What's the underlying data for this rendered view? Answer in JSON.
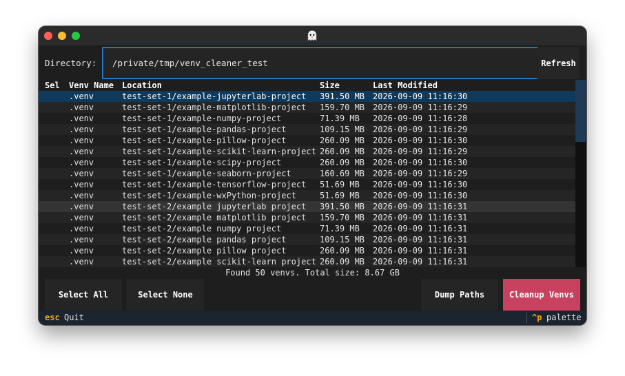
{
  "directory": {
    "label": "Directory:",
    "value": "/private/tmp/venv_cleaner_test"
  },
  "refresh_label": "Refresh",
  "table": {
    "headers": {
      "sel": "Sel",
      "name": "Venv Name",
      "location": "Location",
      "size": "Size",
      "modified": "Last Modified"
    },
    "rows": [
      {
        "name": ".venv",
        "location": "test-set-1/example-jupyterlab-project",
        "size": "391.50 MB",
        "modified": "2026-09-09 11:16:30"
      },
      {
        "name": ".venv",
        "location": "test-set-1/example-matplotlib-project",
        "size": "159.70 MB",
        "modified": "2026-09-09 11:16:29"
      },
      {
        "name": ".venv",
        "location": "test-set-1/example-numpy-project",
        "size": "71.39 MB",
        "modified": "2026-09-09 11:16:28"
      },
      {
        "name": ".venv",
        "location": "test-set-1/example-pandas-project",
        "size": "109.15 MB",
        "modified": "2026-09-09 11:16:29"
      },
      {
        "name": ".venv",
        "location": "test-set-1/example-pillow-project",
        "size": "260.09 MB",
        "modified": "2026-09-09 11:16:30"
      },
      {
        "name": ".venv",
        "location": "test-set-1/example-scikit-learn-project",
        "size": "260.09 MB",
        "modified": "2026-09-09 11:16:29"
      },
      {
        "name": ".venv",
        "location": "test-set-1/example-scipy-project",
        "size": "260.09 MB",
        "modified": "2026-09-09 11:16:30"
      },
      {
        "name": ".venv",
        "location": "test-set-1/example-seaborn-project",
        "size": "160.69 MB",
        "modified": "2026-09-09 11:16:29"
      },
      {
        "name": ".venv",
        "location": "test-set-1/example-tensorflow-project",
        "size": "51.69 MB",
        "modified": "2026-09-09 11:16:30"
      },
      {
        "name": ".venv",
        "location": "test-set-1/example-wxPython-project",
        "size": "51.69 MB",
        "modified": "2026-09-09 11:16:30"
      },
      {
        "name": ".venv",
        "location": "test-set-2/example jupyterlab project",
        "size": "391.50 MB",
        "modified": "2026-09-09 11:16:31"
      },
      {
        "name": ".venv",
        "location": "test-set-2/example matplotlib project",
        "size": "159.70 MB",
        "modified": "2026-09-09 11:16:31"
      },
      {
        "name": ".venv",
        "location": "test-set-2/example numpy project",
        "size": "71.39 MB",
        "modified": "2026-09-09 11:16:31"
      },
      {
        "name": ".venv",
        "location": "test-set-2/example pandas project",
        "size": "109.15 MB",
        "modified": "2026-09-09 11:16:31"
      },
      {
        "name": ".venv",
        "location": "test-set-2/example pillow project",
        "size": "260.09 MB",
        "modified": "2026-09-09 11:16:31"
      },
      {
        "name": ".venv",
        "location": "test-set-2/example scikit-learn project",
        "size": "260.09 MB",
        "modified": "2026-09-09 11:16:31"
      }
    ],
    "cursor_row": 0,
    "hover_row": 10,
    "scroll_fraction": 0.33
  },
  "summary": "Found 50 venvs. Total size: 8.67 GB",
  "buttons": {
    "select_all": "Select All",
    "select_none": "Select None",
    "dump_paths": "Dump Paths",
    "cleanup": "Cleanup Venvs"
  },
  "footer": {
    "quit_key": "esc",
    "quit_label": "Quit",
    "palette_key": "^p",
    "palette_label": "palette"
  },
  "colors": {
    "accent": "#1f76c5",
    "selected_row": "#0f3a5c",
    "danger": "#c8415f",
    "key_hint": "#f4a51c"
  },
  "icons": {
    "app": "ghost-icon"
  }
}
